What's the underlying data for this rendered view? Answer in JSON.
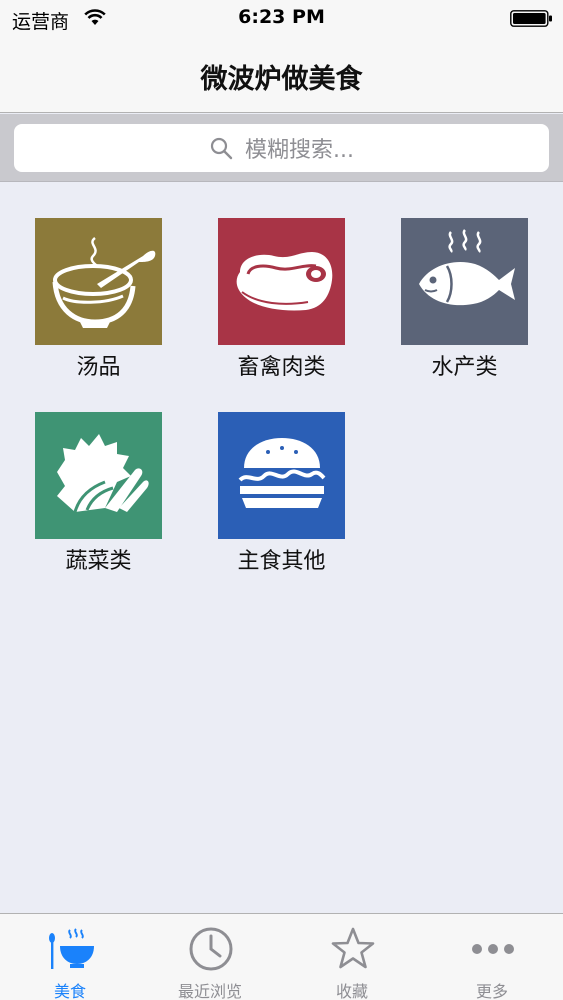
{
  "status_bar": {
    "carrier": "运营商",
    "time": "6:23 PM"
  },
  "nav": {
    "title": "微波炉做美食"
  },
  "search": {
    "placeholder": "模糊搜索..."
  },
  "categories": [
    {
      "label": "汤品",
      "icon": "soup-bowl-icon",
      "color": "#8c7a3a"
    },
    {
      "label": "畜禽肉类",
      "icon": "steak-icon",
      "color": "#a83446"
    },
    {
      "label": "水产类",
      "icon": "fish-icon",
      "color": "#5b6478"
    },
    {
      "label": "蔬菜类",
      "icon": "vegetable-icon",
      "color": "#3f9474"
    },
    {
      "label": "主食其他",
      "icon": "burger-icon",
      "color": "#2b5fb6"
    }
  ],
  "tabs": [
    {
      "label": "美食",
      "icon": "food-bowl-icon",
      "active": true
    },
    {
      "label": "最近浏览",
      "icon": "clock-icon",
      "active": false
    },
    {
      "label": "收藏",
      "icon": "star-icon",
      "active": false
    },
    {
      "label": "更多",
      "icon": "more-dots-icon",
      "active": false
    }
  ],
  "colors": {
    "accent": "#1a82fb",
    "tab_inactive": "#8e8e93",
    "background": "#ebedf5"
  }
}
